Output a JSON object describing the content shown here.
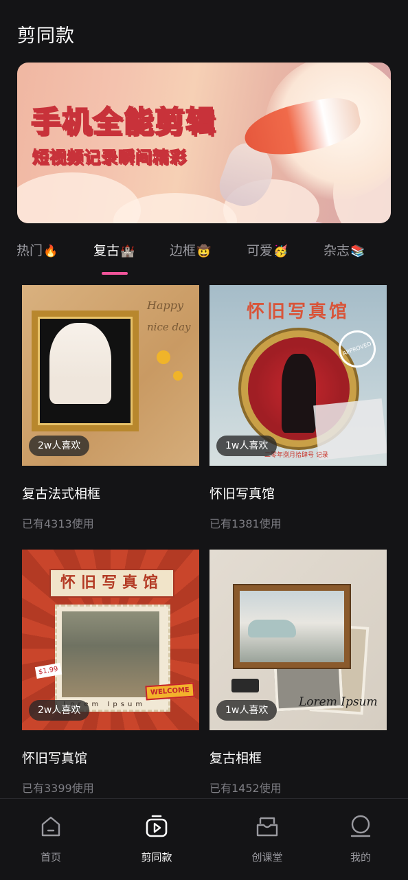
{
  "header": {
    "title": "剪同款"
  },
  "banner": {
    "title": "手机全能剪辑",
    "subtitle": "短视频记录瞬间精彩"
  },
  "tabs": [
    {
      "label": "热门",
      "emoji": "🔥"
    },
    {
      "label": "复古",
      "emoji": "🏰"
    },
    {
      "label": "边框",
      "emoji": "🤠"
    },
    {
      "label": "可爱",
      "emoji": "🥳"
    },
    {
      "label": "杂志",
      "emoji": "📚"
    }
  ],
  "active_tab": "复古",
  "cards": [
    {
      "title": "复古法式相框",
      "likes": "2w人喜欢",
      "usage": "已有4313使用",
      "thumb_text": [
        "Happy",
        "nice day"
      ]
    },
    {
      "title": "怀旧写真馆",
      "likes": "1w人喜欢",
      "usage": "已有1381使用",
      "thumb_text": [
        "怀旧写真馆",
        "APPROVED",
        "二零年捌月拾肆号 记录"
      ]
    },
    {
      "title": "怀旧写真馆",
      "likes": "2w人喜欢",
      "usage": "已有3399使用",
      "thumb_text": [
        "怀旧写真馆",
        "WELCOME",
        "Lorem Ipsum",
        "$1.99"
      ]
    },
    {
      "title": "复古相框",
      "likes": "1w人喜欢",
      "usage": "已有1452使用",
      "thumb_text": [
        "Lorem Ipsum"
      ]
    }
  ],
  "bottom_nav": [
    {
      "label": "首页",
      "icon": "home-icon"
    },
    {
      "label": "剪同款",
      "icon": "play-template-icon"
    },
    {
      "label": "创课堂",
      "icon": "inbox-class-icon"
    },
    {
      "label": "我的",
      "icon": "profile-icon"
    }
  ],
  "active_nav": "剪同款",
  "colors": {
    "background": "#141416",
    "accent": "#f0549a",
    "inactive_text": "#9a9aa0"
  }
}
